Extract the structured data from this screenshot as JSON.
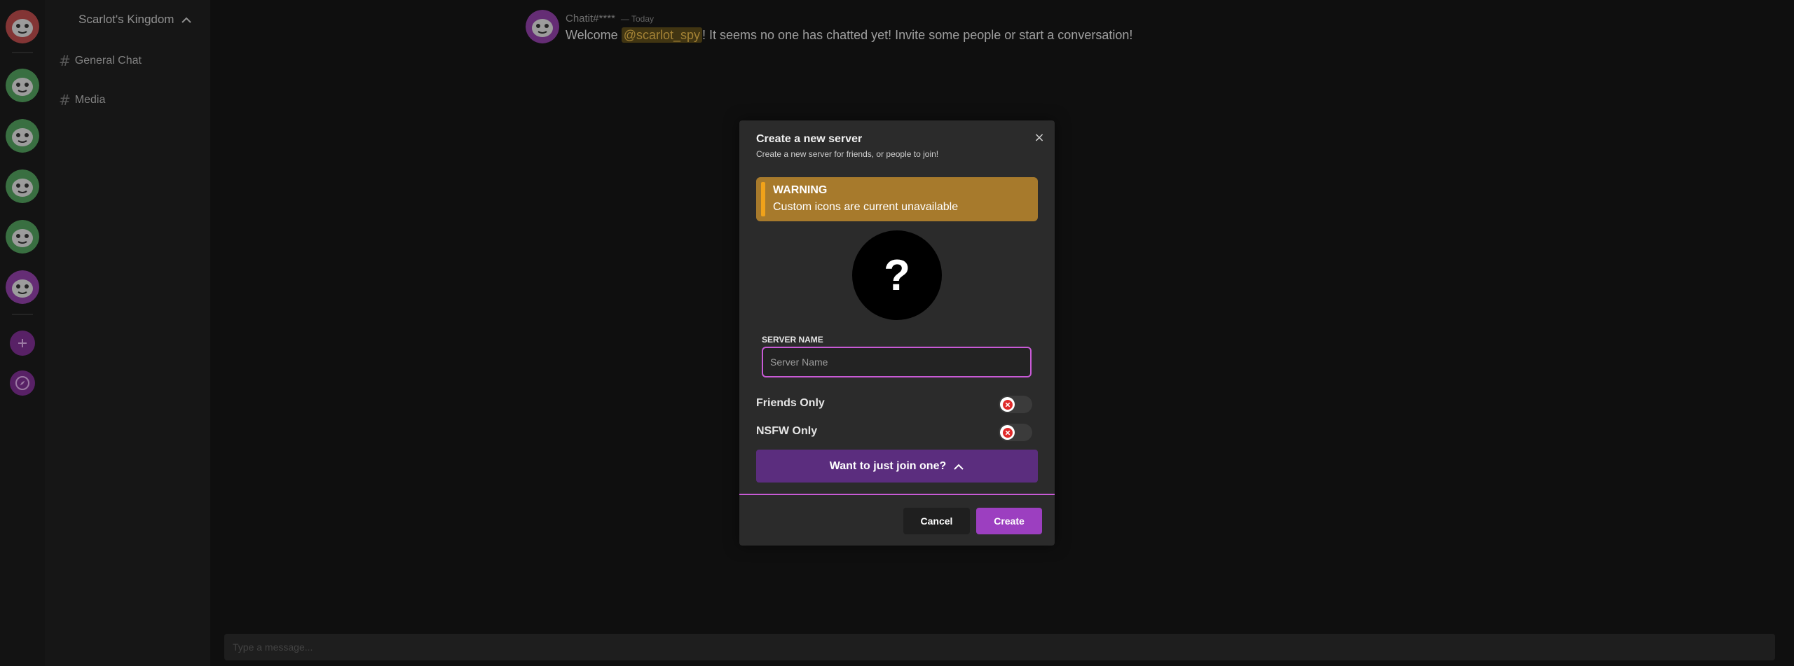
{
  "colors": {
    "accent": "#c85ad6",
    "warning_bg": "#a77a2c",
    "warning_bar": "#f0a21a",
    "primary_button": "#9c3fc0",
    "join_button": "#5b2d7e"
  },
  "rail": {
    "servers": [
      {
        "icon": "red-face-server-icon",
        "color": "#b64a4a"
      },
      {
        "icon": "green-face-server-icon",
        "color": "#4f9a5a"
      },
      {
        "icon": "green-face-server-icon",
        "color": "#4f9a5a"
      },
      {
        "icon": "green-face-server-icon",
        "color": "#4f9a5a"
      },
      {
        "icon": "green-face-server-icon",
        "color": "#4f9a5a"
      },
      {
        "icon": "purple-face-server-icon",
        "color": "#8d3fa3"
      }
    ],
    "add_icon": "plus-icon",
    "explore_icon": "compass-icon"
  },
  "sidebar": {
    "server_name": "Scarlot's Kingdom",
    "channels": [
      {
        "hash": "#",
        "name": "General Chat"
      },
      {
        "hash": "#",
        "name": "Media"
      }
    ]
  },
  "chat": {
    "message": {
      "author": "Chatit#****",
      "time": "— Today",
      "text_before": "Welcome ",
      "mention": "@scarlot_spy",
      "text_after": "! It seems no one has chatted yet! Invite some people or start a conversation!"
    },
    "composer_placeholder": "Type a message..."
  },
  "modal": {
    "title": "Create a new server",
    "subtitle": "Create a new server for friends, or people to join!",
    "close": "×",
    "warning": {
      "title": "WARNING",
      "text": "Custom icons are current unavailable"
    },
    "icon_placeholder": "?",
    "server_name_label": "SERVER NAME",
    "server_name_placeholder": "Server Name",
    "toggles": [
      {
        "label": "Friends Only",
        "on": false
      },
      {
        "label": "NSFW Only",
        "on": false
      }
    ],
    "join_label": "Want to just join one?",
    "cancel_label": "Cancel",
    "create_label": "Create"
  }
}
